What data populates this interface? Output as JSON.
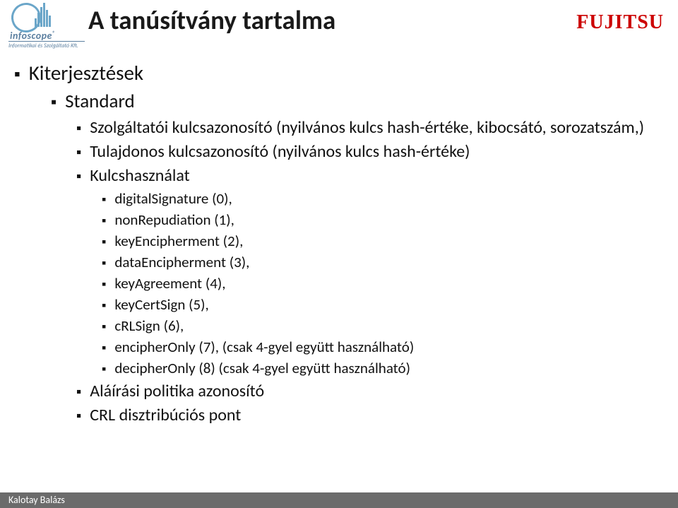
{
  "logo_left": {
    "brand": "infoscope",
    "reg": "®",
    "tagline": "Informatikai és Szolgáltató Kft."
  },
  "title": "A tanúsítvány tartalma",
  "logo_right": {
    "text": "FUJITSU"
  },
  "bullets": {
    "l1_0": "Kiterjesztések",
    "l2_0": "Standard",
    "l3_0": "Szolgáltatói kulcsazonosító (nyilvános kulcs hash-értéke, kibocsátó, sorozatszám,)",
    "l3_1": "Tulajdonos kulcsazonosító (nyilvános kulcs hash-értéke)",
    "l3_2": "Kulcshasználat",
    "l4_0": "digitalSignature (0),",
    "l4_1": "nonRepudiation (1),",
    "l4_2": "keyEncipherment (2),",
    "l4_3": "dataEncipherment (3),",
    "l4_4": "keyAgreement (4),",
    "l4_5": "keyCertSign (5),",
    "l4_6": "cRLSign (6),",
    "l4_7": "encipherOnly (7),  (csak 4-gyel együtt használható)",
    "l4_8": "decipherOnly (8) (csak 4-gyel együtt használható)",
    "l3_3": "Aláírási politika azonosító",
    "l3_4": "CRL disztribúciós pont"
  },
  "footer": "Kalotay Balázs"
}
